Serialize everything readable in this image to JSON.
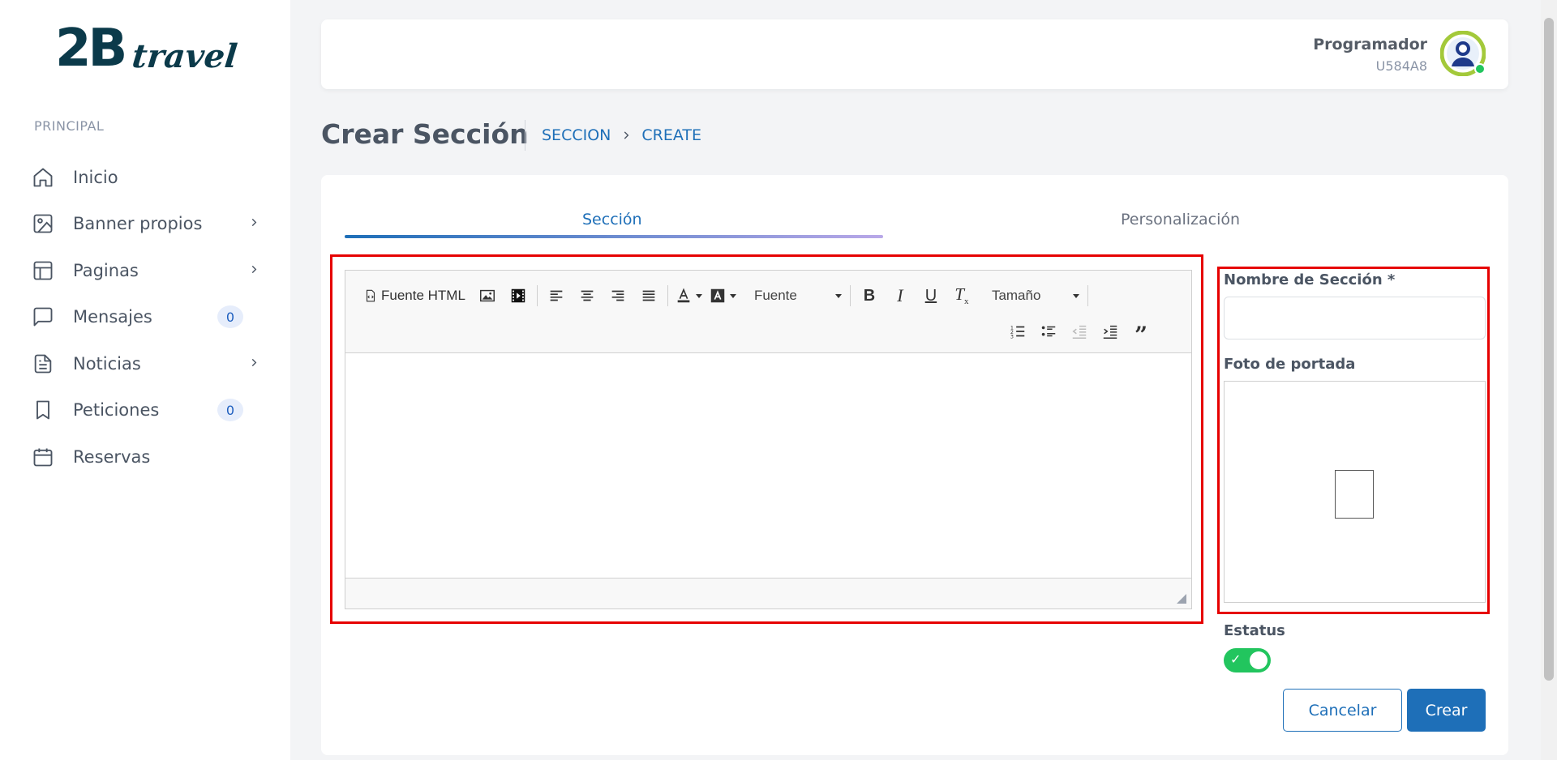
{
  "brand": {
    "logo_main": "2B",
    "logo_sub": "travel"
  },
  "sidebar": {
    "section_label": "PRINCIPAL",
    "items": [
      {
        "label": "Inicio",
        "icon": "home-icon"
      },
      {
        "label": "Banner propios",
        "icon": "image-icon",
        "has_children": true
      },
      {
        "label": "Paginas",
        "icon": "layout-icon",
        "has_children": true
      },
      {
        "label": "Mensajes",
        "icon": "message-icon",
        "badge": "0"
      },
      {
        "label": "Noticias",
        "icon": "document-icon",
        "has_children": true
      },
      {
        "label": "Peticiones",
        "icon": "bookmark-icon",
        "badge": "0"
      },
      {
        "label": "Reservas",
        "icon": "calendar-icon"
      }
    ]
  },
  "header": {
    "user_name": "Programador",
    "user_code": "U584A8"
  },
  "page": {
    "title": "Crear Sección",
    "breadcrumb": [
      "SECCION",
      "CREATE"
    ]
  },
  "tabs": [
    {
      "label": "Sección",
      "active": true
    },
    {
      "label": "Personalización",
      "active": false
    }
  ],
  "editor": {
    "source_label": "Fuente HTML",
    "font_combo": "Fuente",
    "size_combo": "Tamaño",
    "content": ""
  },
  "form": {
    "name_label": "Nombre de Sección *",
    "name_value": "",
    "photo_label": "Foto de portada",
    "status_label": "Estatus",
    "status_on": true,
    "cancel_label": "Cancelar",
    "create_label": "Crear"
  },
  "colors": {
    "accent": "#1e6fb8",
    "highlight": "#e60000",
    "toggle_on": "#22c55e",
    "logo": "#0b3a4a"
  }
}
